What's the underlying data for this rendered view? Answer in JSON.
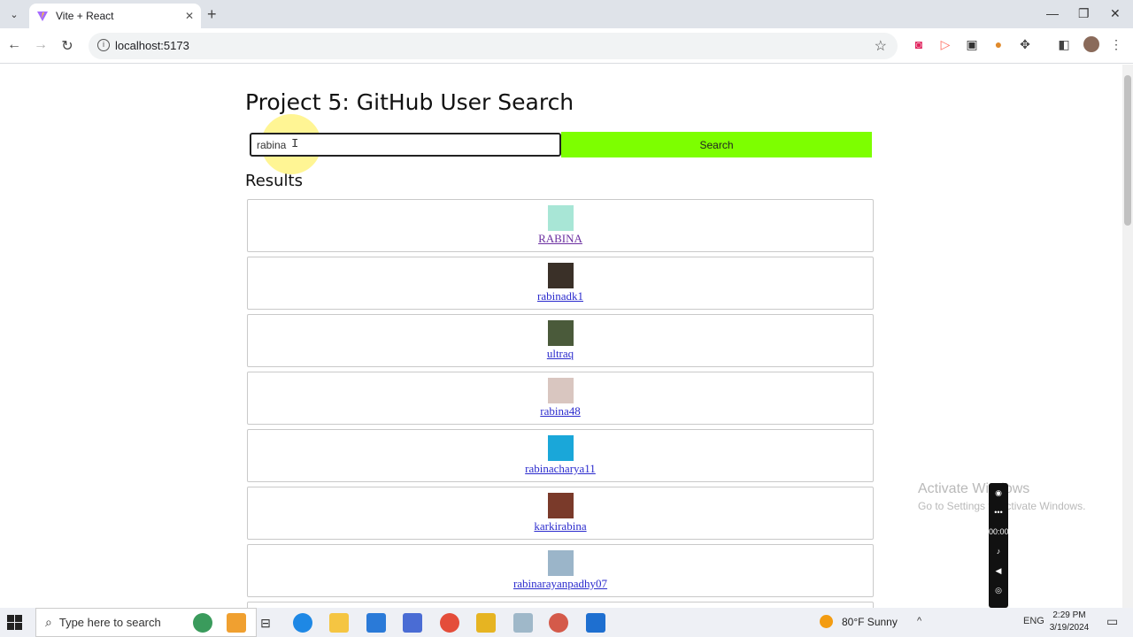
{
  "browser": {
    "tab_title": "Vite + React",
    "url": "localhost:5173",
    "new_tab_glyph": "+",
    "close_glyph": "✕"
  },
  "page": {
    "title": "Project 5: GitHub User Search",
    "search_value": "rabina",
    "search_button": "Search",
    "results_title": "Results",
    "results": [
      {
        "login": "RABINA",
        "avatar_color": "#a8e6d6",
        "visited": true
      },
      {
        "login": "rabinadk1",
        "avatar_color": "#3a3028",
        "visited": false
      },
      {
        "login": "ultraq",
        "avatar_color": "#4a5a3a",
        "visited": false
      },
      {
        "login": "rabina48",
        "avatar_color": "#d9c6c0",
        "visited": false
      },
      {
        "login": "rabinacharya11",
        "avatar_color": "#1aa7d9",
        "visited": false
      },
      {
        "login": "karkirabina",
        "avatar_color": "#7a3a2a",
        "visited": false
      },
      {
        "login": "rabinarayanpadhy07",
        "avatar_color": "#9bb5c9",
        "visited": false
      }
    ]
  },
  "watermark": {
    "line1": "Activate Windows",
    "line2": "Go to Settings to activate Windows."
  },
  "recorder": {
    "timer": "00:00"
  },
  "taskbar": {
    "search_placeholder": "Type here to search",
    "weather": "80°F  Sunny",
    "language": "ENG",
    "time": "2:29 PM",
    "date": "3/19/2024"
  },
  "colors": {
    "search_button_bg": "#7dff00",
    "link": "#2a2acd",
    "link_visited": "#6b2fa0"
  }
}
